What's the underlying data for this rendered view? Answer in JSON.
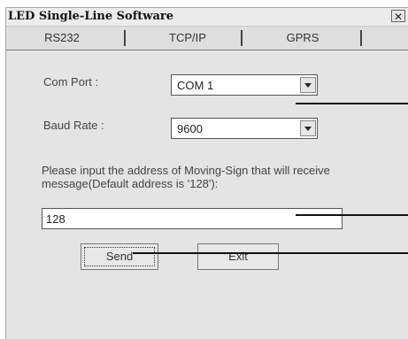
{
  "window": {
    "title": "LED Single-Line Software",
    "close_glyph": "✕"
  },
  "tabs": [
    {
      "label": "RS232",
      "selected": true
    },
    {
      "label": "TCP/IP",
      "selected": false
    },
    {
      "label": "GPRS",
      "selected": false
    }
  ],
  "form": {
    "com_port_label": "Com Port :",
    "com_port_value": "COM 1",
    "baud_rate_label": "Baud Rate :",
    "baud_rate_value": "9600",
    "address_prompt_line1": "Please input the address of Moving-Sign that will receive",
    "address_prompt_line2": "message(Default address is '128'):",
    "address_value": "128"
  },
  "buttons": {
    "send": "Send",
    "exit": "Exit"
  }
}
